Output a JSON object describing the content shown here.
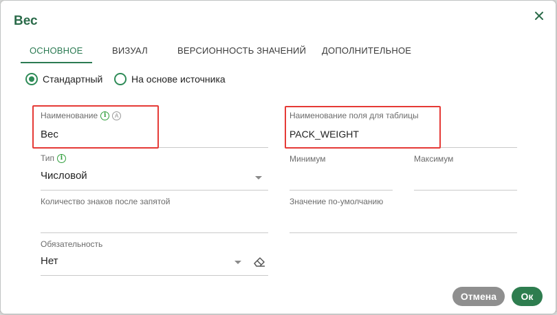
{
  "dialog": {
    "title": "Вес",
    "tabs": [
      {
        "label": "ОСНОВНОЕ",
        "active": true
      },
      {
        "label": "ВИЗУАЛ",
        "active": false
      },
      {
        "label": "ВЕРСИОННОСТЬ ЗНАЧЕНИЙ",
        "active": false
      },
      {
        "label": "ДОПОЛНИТЕЛЬНОЕ",
        "active": false
      }
    ],
    "radio": [
      {
        "label": "Стандартный",
        "checked": true
      },
      {
        "label": "На основе источника",
        "checked": false
      }
    ]
  },
  "fields": {
    "name": {
      "label": "Наименование",
      "value": "Вес"
    },
    "table_field": {
      "label": "Наименование поля для таблицы",
      "value": "PACK_WEIGHT"
    },
    "type": {
      "label": "Тип",
      "value": "Числовой"
    },
    "min": {
      "label": "Минимум",
      "value": ""
    },
    "max": {
      "label": "Максимум",
      "value": ""
    },
    "decimals": {
      "label": "Количество знаков после запятой",
      "value": ""
    },
    "default": {
      "label": "Значение по-умолчанию",
      "value": ""
    },
    "required": {
      "label": "Обязательность",
      "value": "Нет"
    }
  },
  "buttons": {
    "cancel": "Отмена",
    "ok": "Ок"
  },
  "colors": {
    "accent": "#2b7a52",
    "highlight": "#e53935",
    "cancel": "#8f8f8f",
    "ok": "#2e7d4f"
  }
}
